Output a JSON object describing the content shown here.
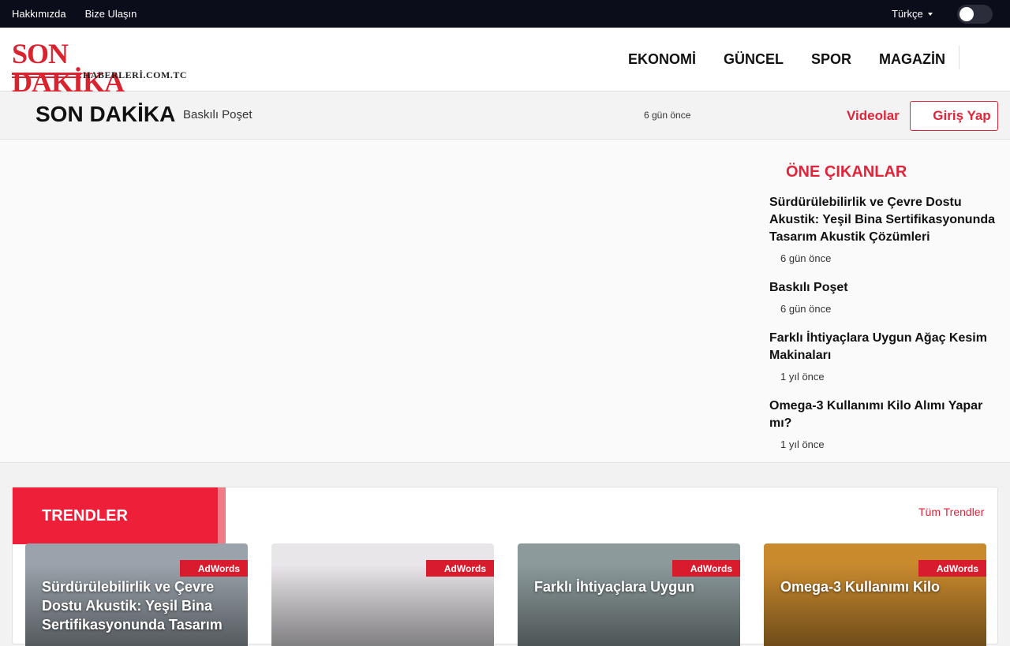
{
  "topbar": {
    "links": [
      "Hakkımızda",
      "Bize Ulaşın"
    ],
    "language": "Türkçe"
  },
  "header": {
    "logo_main": "SON DAKİKA",
    "logo_sub": "HABERLERİ.COM.TC",
    "nav": [
      "EKONOMİ",
      "GÜNCEL",
      "SPOR",
      "MAGAZİN"
    ]
  },
  "breaking": {
    "label": "SON DAKİKA",
    "headline": "Baskılı Poşet",
    "time": "6 gün önce",
    "videos": "Videolar",
    "login": "Giriş Yap"
  },
  "featured": {
    "title": "ÖNE ÇIKANLAR",
    "items": [
      {
        "title": "Sürdürülebilirlik ve Çevre Dostu Akustik: Yeşil Bina Sertifikasyonunda Tasarım Akustik Çözümleri",
        "time": "6 gün önce"
      },
      {
        "title": "Baskılı Poşet",
        "time": "6 gün önce"
      },
      {
        "title": "Farklı İhtiyaçlara Uygun Ağaç Kesim Makinaları",
        "time": "1 yıl önce"
      },
      {
        "title": "Omega-3 Kullanımı Kilo Alımı Yapar mı?",
        "time": "1 yıl önce"
      }
    ]
  },
  "trends": {
    "title": "TRENDLER",
    "all_label": "Tüm Trendler",
    "cards": [
      {
        "tag": "AdWords",
        "title": "Sürdürülebilirlik ve Çevre Dostu Akustik: Yeşil Bina Sertifikasyonunda Tasarım",
        "bg": "#9aa3ab"
      },
      {
        "tag": "AdWords",
        "title": "",
        "bg": "#e9e6ea"
      },
      {
        "tag": "AdWords",
        "title": "Farklı İhtiyaçlara Uygun",
        "bg": "#8c9a9c"
      },
      {
        "tag": "AdWords",
        "title": "Omega-3 Kullanımı Kilo",
        "bg": "#c98a2e"
      }
    ]
  },
  "colors": {
    "accent": "#e0253b",
    "topbar": "#0b0d1a"
  }
}
